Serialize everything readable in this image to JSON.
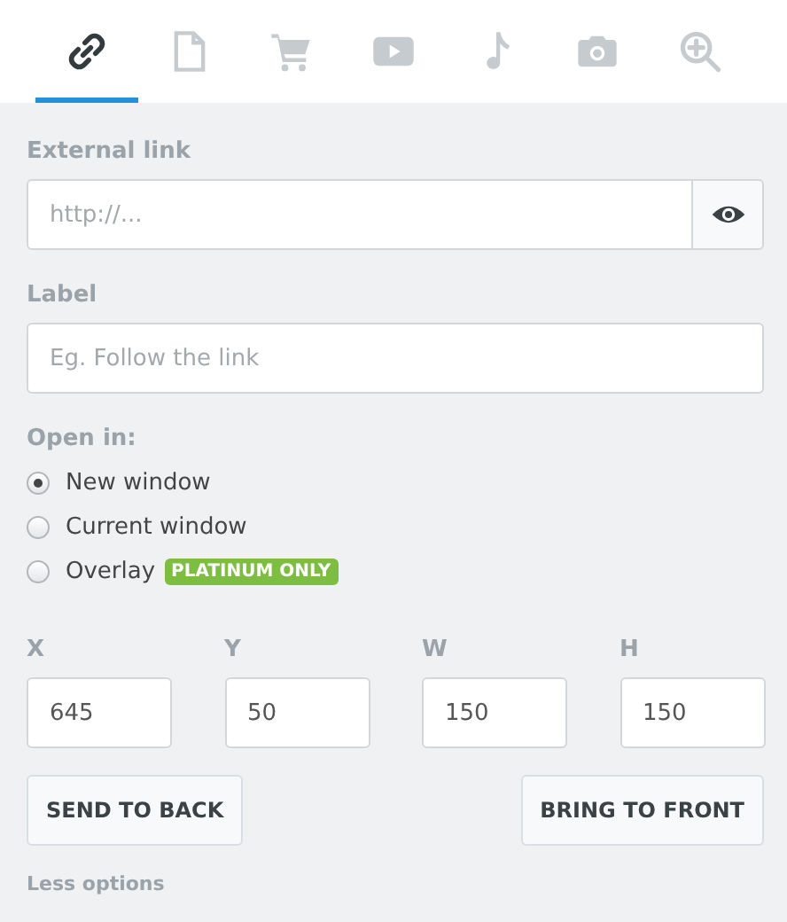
{
  "tabs": [
    {
      "kind": "link",
      "selected": true
    },
    {
      "kind": "page",
      "selected": false
    },
    {
      "kind": "cart",
      "selected": false
    },
    {
      "kind": "video",
      "selected": false
    },
    {
      "kind": "music",
      "selected": false
    },
    {
      "kind": "camera",
      "selected": false
    },
    {
      "kind": "zoom",
      "selected": false
    }
  ],
  "external_link": {
    "label": "External link",
    "placeholder": "http://..."
  },
  "link_label": {
    "label": "Label",
    "placeholder": "Eg. Follow the link"
  },
  "open_in": {
    "label": "Open in:",
    "options": [
      {
        "label": "New window",
        "selected": true
      },
      {
        "label": "Current window",
        "selected": false
      },
      {
        "label": "Overlay",
        "selected": false,
        "badge": "PLATINUM ONLY"
      }
    ]
  },
  "coordinates": [
    {
      "label": "X",
      "value": "645"
    },
    {
      "label": "Y",
      "value": "50"
    },
    {
      "label": "W",
      "value": "150"
    },
    {
      "label": "H",
      "value": "150"
    }
  ],
  "buttons": [
    "SEND TO BACK",
    "BRING TO FRONT"
  ],
  "less_options": "Less options"
}
